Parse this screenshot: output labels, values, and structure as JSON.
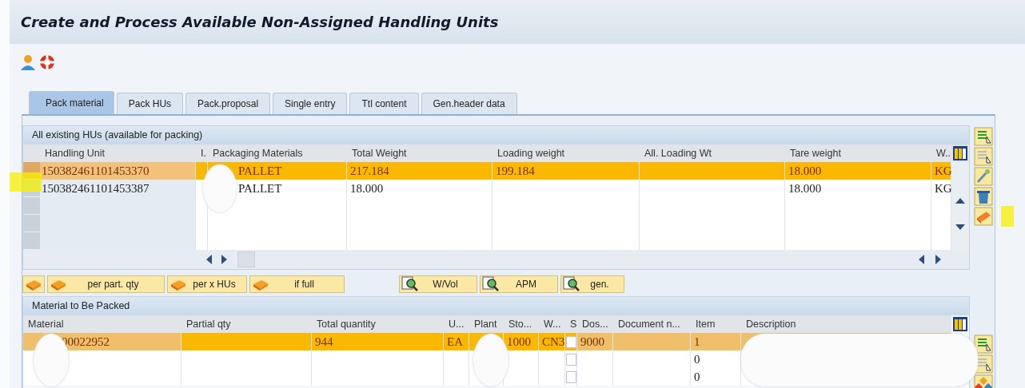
{
  "window": {
    "title": "Create and Process Available Non-Assigned Handling Units"
  },
  "tabs": [
    {
      "label": "Pack material",
      "selected": true
    },
    {
      "label": "Pack HUs",
      "selected": false
    },
    {
      "label": "Pack.proposal",
      "selected": false
    },
    {
      "label": "Single entry",
      "selected": false
    },
    {
      "label": "Ttl content",
      "selected": false
    },
    {
      "label": "Gen.header data",
      "selected": false
    }
  ],
  "hu_table": {
    "title": "All existing HUs (available for packing)",
    "columns": [
      {
        "label": "Handling Unit",
        "kind": "key"
      },
      {
        "label": "I.",
        "kind": "plain"
      },
      {
        "label": "Packaging Materials",
        "kind": "plain"
      },
      {
        "label": "Total Weight",
        "kind": "plain"
      },
      {
        "label": "Loading weight",
        "kind": "plain"
      },
      {
        "label": "All. Loading Wt",
        "kind": "plain"
      },
      {
        "label": "Tare weight",
        "kind": "plain"
      },
      {
        "label": "W...",
        "kind": "plain"
      }
    ],
    "rows": [
      {
        "selected": true,
        "cells": [
          "150382461101453370",
          null,
          "PALLET",
          "217.184",
          "199.184",
          null,
          "18.000",
          "KG"
        ]
      },
      {
        "selected": false,
        "cells": [
          "150382461101453387",
          null,
          "PALLET",
          "18.000",
          null,
          null,
          "18.000",
          "KG"
        ]
      }
    ]
  },
  "buttons": [
    {
      "kind": "pack"
    },
    {
      "label": "per part. qty",
      "kind": "pack"
    },
    {
      "label": "per x HUs",
      "kind": "pack"
    },
    {
      "label": "if full",
      "kind": "pack"
    },
    {
      "label": "W/Vol",
      "kind": "find"
    },
    {
      "label": "APM",
      "kind": "find"
    },
    {
      "label": "gen.",
      "kind": "find"
    }
  ],
  "material_table": {
    "title": "Material to Be Packed",
    "columns": [
      {
        "label": "Material",
        "kind": "plain"
      },
      {
        "label": "Partial qty",
        "kind": "plain"
      },
      {
        "label": "Total quantity",
        "kind": "plain"
      },
      {
        "label": "U...",
        "kind": "plain"
      },
      {
        "label": "Plant",
        "kind": "plain"
      },
      {
        "label": "Sto...",
        "kind": "plain"
      },
      {
        "label": "W...",
        "kind": "plain"
      },
      {
        "label": "S",
        "kind": "checkbox"
      },
      {
        "label": "Dos...",
        "kind": "plain"
      },
      {
        "label": "Document n...",
        "kind": "plain"
      },
      {
        "label": "Item",
        "kind": "plain"
      },
      {
        "label": "Description",
        "kind": "plain"
      }
    ],
    "rows": [
      {
        "selected": true,
        "checked": false,
        "cells": [
          "00022952",
          null,
          "944",
          "EA",
          null,
          "1000",
          "CN3",
          null,
          "9000",
          null,
          "1",
          null
        ]
      },
      {
        "selected": false,
        "checked": false,
        "cells": [
          null,
          null,
          null,
          null,
          null,
          null,
          null,
          null,
          null,
          null,
          "0",
          null
        ]
      },
      {
        "selected": false,
        "checked": false,
        "cells": [
          null,
          null,
          null,
          null,
          null,
          null,
          null,
          null,
          null,
          null,
          "0",
          null
        ]
      }
    ]
  }
}
